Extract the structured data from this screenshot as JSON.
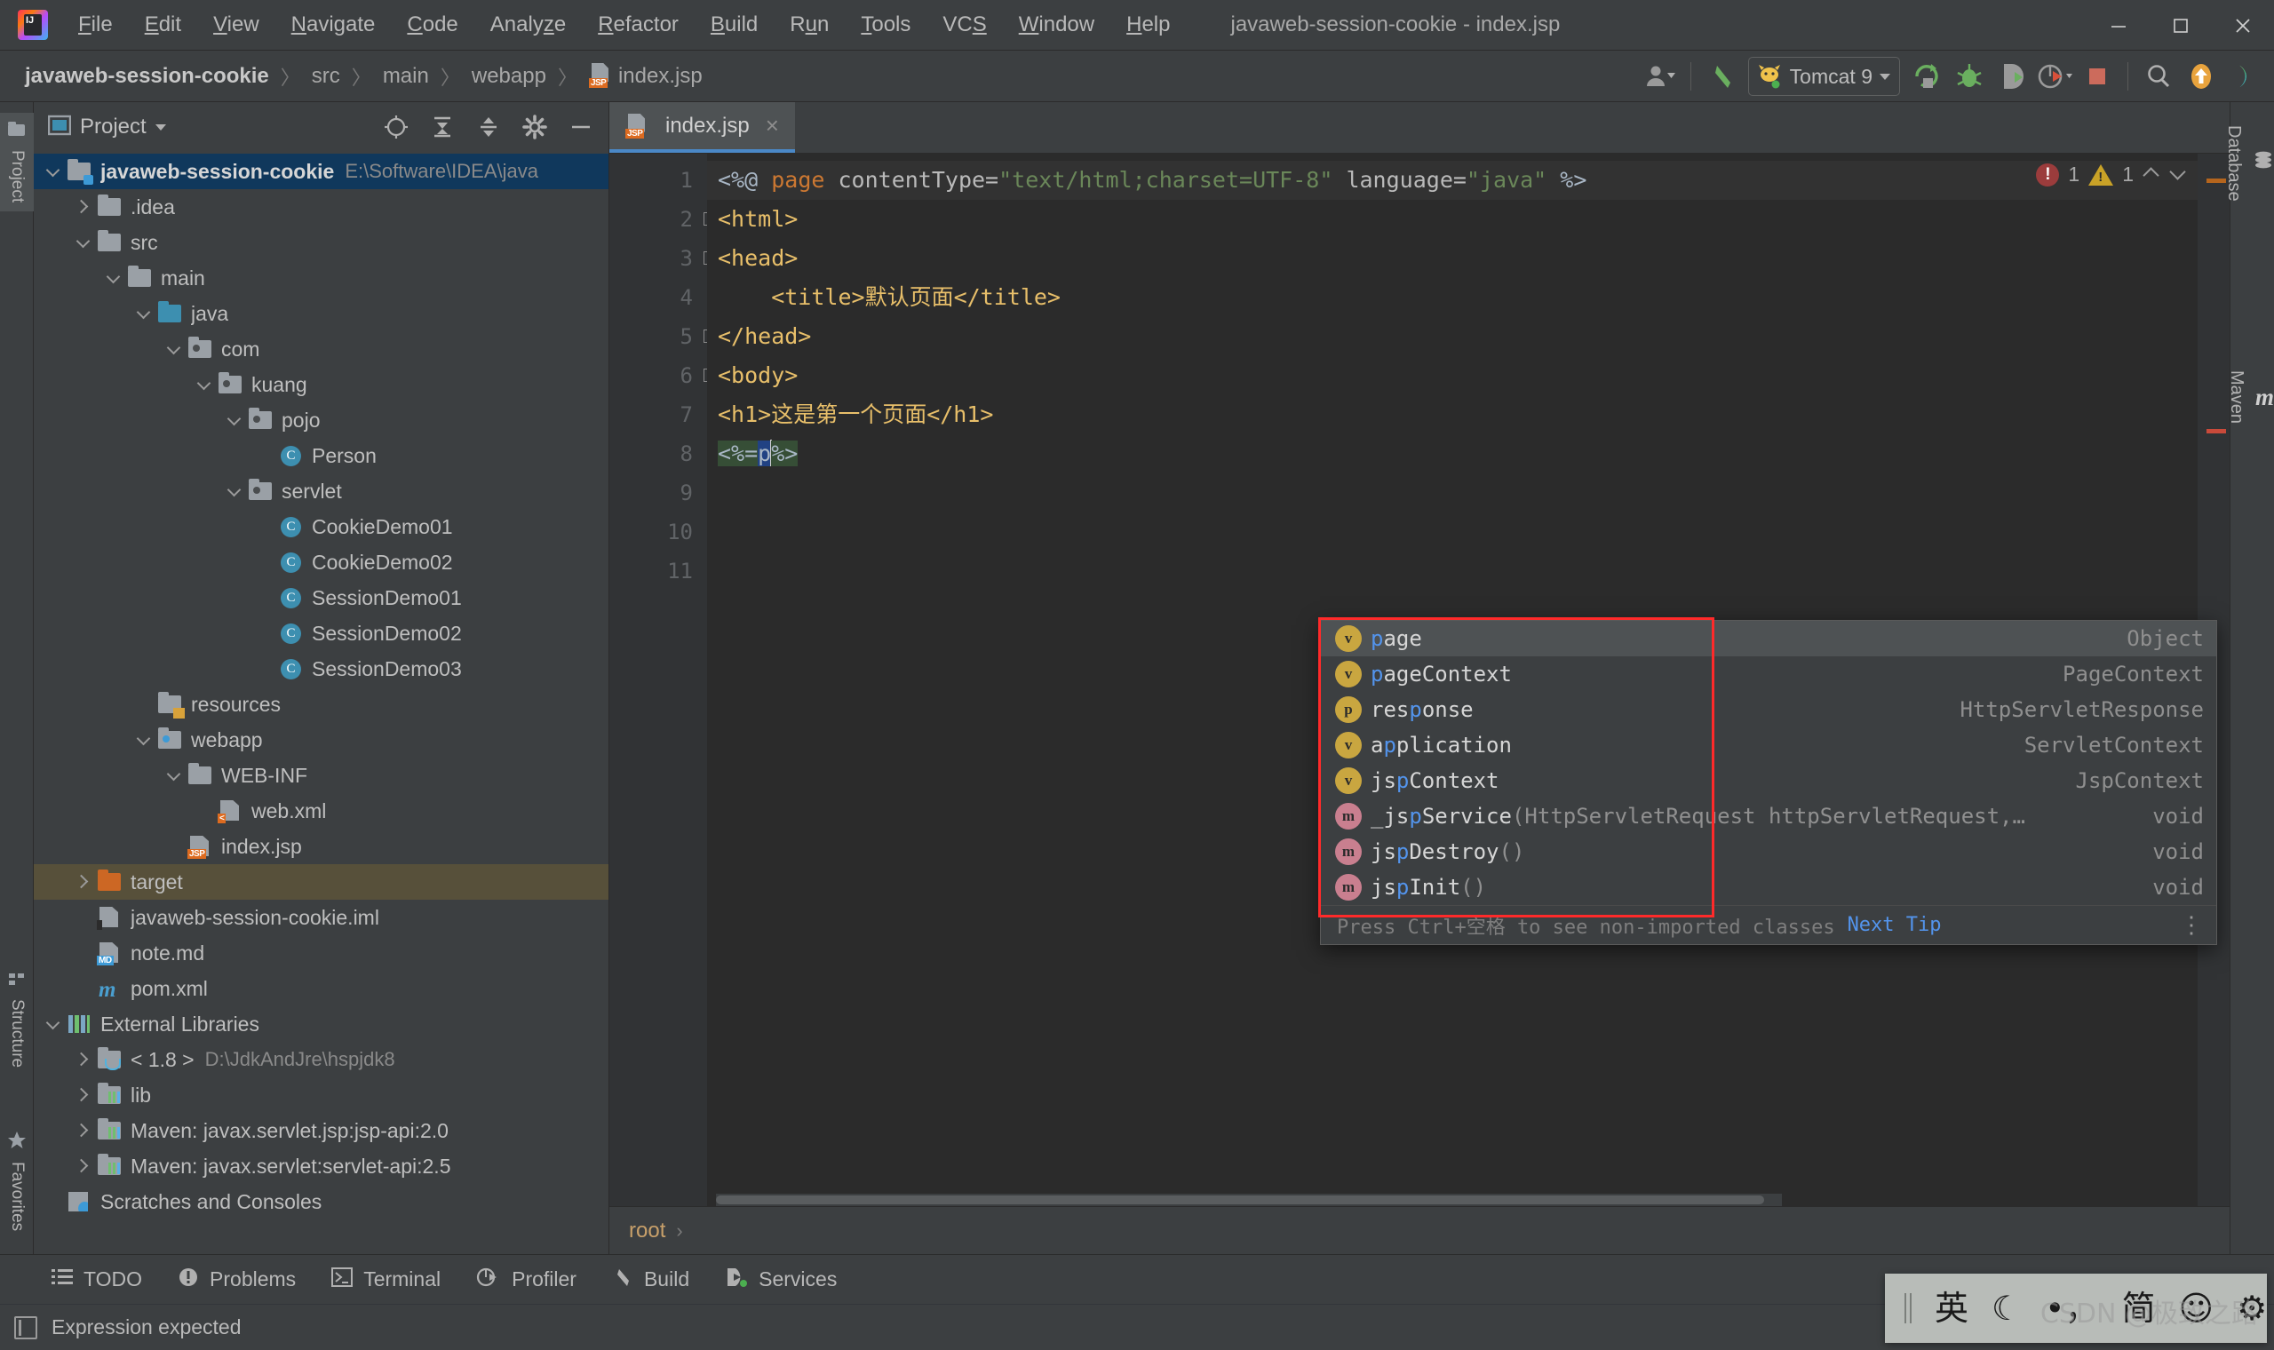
{
  "window": {
    "title": "javaweb-session-cookie - index.jsp",
    "logo_name": "intellij-idea-logo"
  },
  "menu": {
    "items": [
      {
        "label": "File",
        "mnemonic": "F"
      },
      {
        "label": "Edit",
        "mnemonic": "E"
      },
      {
        "label": "View",
        "mnemonic": "V"
      },
      {
        "label": "Navigate",
        "mnemonic": "N"
      },
      {
        "label": "Code",
        "mnemonic": "C"
      },
      {
        "label": "Analyze",
        "mnemonic": "z"
      },
      {
        "label": "Refactor",
        "mnemonic": "R"
      },
      {
        "label": "Build",
        "mnemonic": "B"
      },
      {
        "label": "Run",
        "mnemonic": "u"
      },
      {
        "label": "Tools",
        "mnemonic": "T"
      },
      {
        "label": "VCS",
        "mnemonic": "S"
      },
      {
        "label": "Window",
        "mnemonic": "W"
      },
      {
        "label": "Help",
        "mnemonic": "H"
      }
    ]
  },
  "window_controls": {
    "minimize": "minimize-icon",
    "maximize": "maximize-icon",
    "close": "close-icon"
  },
  "navbar": {
    "breadcrumb": [
      "javaweb-session-cookie",
      "src",
      "main",
      "webapp",
      "index.jsp"
    ],
    "file_icon_label": "JSP"
  },
  "toolbar": {
    "user_icon": "user-avatar-icon",
    "back_icon": "back-arrow-icon",
    "run_config": "Tomcat 9",
    "run_icon": "run-icon",
    "debug_icon": "debug-icon",
    "run_coverage_icon": "run-with-coverage-icon",
    "profile_icon": "profiler-icon",
    "stop_icon": "stop-icon",
    "search_icon": "search-everywhere-icon",
    "update_icon": "update-project-icon",
    "settings_icon": "ide-settings-icon"
  },
  "left_stripe": [
    {
      "label": "Project",
      "active": true
    },
    {
      "label": "Structure",
      "active": false
    },
    {
      "label": "Favorites",
      "active": false
    }
  ],
  "right_stripe": [
    {
      "label": "Database"
    },
    {
      "label": "Maven"
    }
  ],
  "project_panel": {
    "title": "Project",
    "actions": [
      "locate-icon",
      "expand-all-icon",
      "collapse-all-icon",
      "settings-icon",
      "hide-icon"
    ],
    "tree": [
      {
        "label": "javaweb-session-cookie",
        "sub": "E:\\Software\\IDEA\\java",
        "depth": 0,
        "arrow": "down",
        "icon": "module-folder",
        "bold": true,
        "selected": "blue"
      },
      {
        "label": ".idea",
        "sub": "",
        "depth": 1,
        "arrow": "right",
        "icon": "folder-grey",
        "bold": false,
        "selected": ""
      },
      {
        "label": "src",
        "sub": "",
        "depth": 1,
        "arrow": "down",
        "icon": "folder-grey",
        "bold": false,
        "selected": ""
      },
      {
        "label": "main",
        "sub": "",
        "depth": 2,
        "arrow": "down",
        "icon": "folder-grey",
        "bold": false,
        "selected": ""
      },
      {
        "label": "java",
        "sub": "",
        "depth": 3,
        "arrow": "down",
        "icon": "folder-source",
        "bold": false,
        "selected": ""
      },
      {
        "label": "com",
        "sub": "",
        "depth": 4,
        "arrow": "down",
        "icon": "folder-package",
        "bold": false,
        "selected": ""
      },
      {
        "label": "kuang",
        "sub": "",
        "depth": 5,
        "arrow": "down",
        "icon": "folder-package",
        "bold": false,
        "selected": ""
      },
      {
        "label": "pojo",
        "sub": "",
        "depth": 6,
        "arrow": "down",
        "icon": "folder-package",
        "bold": false,
        "selected": ""
      },
      {
        "label": "Person",
        "sub": "",
        "depth": 7,
        "arrow": "blank",
        "icon": "class-icon",
        "bold": false,
        "selected": ""
      },
      {
        "label": "servlet",
        "sub": "",
        "depth": 6,
        "arrow": "down",
        "icon": "folder-package",
        "bold": false,
        "selected": ""
      },
      {
        "label": "CookieDemo01",
        "sub": "",
        "depth": 7,
        "arrow": "blank",
        "icon": "class-icon",
        "bold": false,
        "selected": ""
      },
      {
        "label": "CookieDemo02",
        "sub": "",
        "depth": 7,
        "arrow": "blank",
        "icon": "class-icon",
        "bold": false,
        "selected": ""
      },
      {
        "label": "SessionDemo01",
        "sub": "",
        "depth": 7,
        "arrow": "blank",
        "icon": "class-icon",
        "bold": false,
        "selected": ""
      },
      {
        "label": "SessionDemo02",
        "sub": "",
        "depth": 7,
        "arrow": "blank",
        "icon": "class-icon",
        "bold": false,
        "selected": ""
      },
      {
        "label": "SessionDemo03",
        "sub": "",
        "depth": 7,
        "arrow": "blank",
        "icon": "class-icon",
        "bold": false,
        "selected": ""
      },
      {
        "label": "resources",
        "sub": "",
        "depth": 3,
        "arrow": "blank",
        "icon": "folder-resources",
        "bold": false,
        "selected": ""
      },
      {
        "label": "webapp",
        "sub": "",
        "depth": 3,
        "arrow": "down",
        "icon": "folder-webapp",
        "bold": false,
        "selected": ""
      },
      {
        "label": "WEB-INF",
        "sub": "",
        "depth": 4,
        "arrow": "down",
        "icon": "folder-grey",
        "bold": false,
        "selected": ""
      },
      {
        "label": "web.xml",
        "sub": "",
        "depth": 5,
        "arrow": "blank",
        "icon": "file-xml",
        "bold": false,
        "selected": ""
      },
      {
        "label": "index.jsp",
        "sub": "",
        "depth": 4,
        "arrow": "blank",
        "icon": "file-jsp",
        "bold": false,
        "selected": ""
      },
      {
        "label": "target",
        "sub": "",
        "depth": 1,
        "arrow": "right",
        "icon": "folder-excluded",
        "bold": false,
        "selected": "olive"
      },
      {
        "label": "javaweb-session-cookie.iml",
        "sub": "",
        "depth": 1,
        "arrow": "blank",
        "icon": "file-iml",
        "bold": false,
        "selected": ""
      },
      {
        "label": "note.md",
        "sub": "",
        "depth": 1,
        "arrow": "blank",
        "icon": "file-md",
        "bold": false,
        "selected": ""
      },
      {
        "label": "pom.xml",
        "sub": "",
        "depth": 1,
        "arrow": "blank",
        "icon": "file-maven",
        "bold": false,
        "selected": ""
      },
      {
        "label": "External Libraries",
        "sub": "",
        "depth": 0,
        "arrow": "down",
        "icon": "libraries-icon",
        "bold": false,
        "selected": ""
      },
      {
        "label": "< 1.8 >",
        "sub": "D:\\JdkAndJre\\hspjdk8",
        "depth": 1,
        "arrow": "right",
        "icon": "jdk-icon",
        "bold": false,
        "selected": ""
      },
      {
        "label": "lib",
        "sub": "",
        "depth": 1,
        "arrow": "right",
        "icon": "jar-icon",
        "bold": false,
        "selected": ""
      },
      {
        "label": "Maven: javax.servlet.jsp:jsp-api:2.0",
        "sub": "",
        "depth": 1,
        "arrow": "right",
        "icon": "jar-icon",
        "bold": false,
        "selected": ""
      },
      {
        "label": "Maven: javax.servlet:servlet-api:2.5",
        "sub": "",
        "depth": 1,
        "arrow": "right",
        "icon": "jar-icon",
        "bold": false,
        "selected": ""
      },
      {
        "label": "Scratches and Consoles",
        "sub": "",
        "depth": 0,
        "arrow": "blank",
        "icon": "scratches-icon",
        "bold": false,
        "selected": ""
      }
    ]
  },
  "editor": {
    "tab": {
      "label": "index.jsp",
      "icon": "JSP",
      "close": "×"
    },
    "inspection": {
      "errors": "1",
      "warnings": "1",
      "up": "chevron-up-icon",
      "down": "chevron-down-icon"
    },
    "line_numbers": [
      "1",
      "2",
      "3",
      "4",
      "5",
      "6",
      "7",
      "8",
      "9",
      "10",
      "11"
    ],
    "lines": [
      {
        "n": "1",
        "segments": [
          {
            "t": "<%@ ",
            "c": "tk-gray"
          },
          {
            "t": "page ",
            "c": "tk-orange"
          },
          {
            "t": "contentType=",
            "c": "tk-attr"
          },
          {
            "t": "\"text/html;charset=UTF-8\"",
            "c": "tk-green"
          },
          {
            "t": " language=",
            "c": "tk-attr"
          },
          {
            "t": "\"java\"",
            "c": "tk-green"
          },
          {
            "t": " %>",
            "c": "tk-gray"
          }
        ]
      },
      {
        "n": "2",
        "segments": [
          {
            "t": "<html>",
            "c": "tk-tag"
          }
        ]
      },
      {
        "n": "3",
        "segments": [
          {
            "t": "<head>",
            "c": "tk-tag"
          }
        ]
      },
      {
        "n": "4",
        "segments": [
          {
            "t": "    <title>默认页面</title>",
            "c": "tk-tag"
          }
        ]
      },
      {
        "n": "5",
        "segments": [
          {
            "t": "</head>",
            "c": "tk-tag"
          }
        ]
      },
      {
        "n": "6",
        "segments": [
          {
            "t": "<body>",
            "c": "tk-tag"
          }
        ]
      },
      {
        "n": "7",
        "segments": [
          {
            "t": "<h1>这是第一个页面</h1>",
            "c": "tk-tag"
          }
        ]
      },
      {
        "n": "8",
        "segments": [
          {
            "t": "<%=p%>",
            "c": "tk-gray"
          }
        ]
      }
    ],
    "breadcrumb_bottom": "root"
  },
  "completion_popup": {
    "items": [
      {
        "kind": "v",
        "name_pre": "",
        "name_match": "p",
        "name_post": "age",
        "sig": "",
        "type": "Object",
        "active": true
      },
      {
        "kind": "v",
        "name_pre": "",
        "name_match": "p",
        "name_post": "ageContext",
        "sig": "",
        "type": "PageContext",
        "active": false
      },
      {
        "kind": "p",
        "name_pre": "res",
        "name_match": "p",
        "name_post": "onse",
        "sig": "",
        "type": "HttpServletResponse",
        "active": false
      },
      {
        "kind": "v",
        "name_pre": "a",
        "name_match": "p",
        "name_post": "plication",
        "sig": "",
        "type": "ServletContext",
        "active": false
      },
      {
        "kind": "v",
        "name_pre": "js",
        "name_match": "p",
        "name_post": "Context",
        "sig": "",
        "type": "JspContext",
        "active": false
      },
      {
        "kind": "m",
        "name_pre": "_js",
        "name_match": "p",
        "name_post": "Service",
        "sig": "(HttpServletRequest httpServletRequest,…",
        "type": "void",
        "active": false
      },
      {
        "kind": "m",
        "name_pre": "js",
        "name_match": "p",
        "name_post": "Destroy",
        "sig": "()",
        "type": "void",
        "active": false
      },
      {
        "kind": "m",
        "name_pre": "js",
        "name_match": "p",
        "name_post": "Init",
        "sig": "()",
        "type": "void",
        "active": false
      }
    ],
    "footer_hint": "Press Ctrl+空格 to see non-imported classes",
    "footer_link": "Next Tip",
    "footer_menu": "more-options-icon"
  },
  "bottom_tools": [
    {
      "label": "TODO",
      "icon": "todo-icon"
    },
    {
      "label": "Problems",
      "icon": "problems-icon"
    },
    {
      "label": "Terminal",
      "icon": "terminal-icon"
    },
    {
      "label": "Profiler",
      "icon": "profiler-icon"
    },
    {
      "label": "Build",
      "icon": "build-icon"
    },
    {
      "label": "Services",
      "icon": "services-icon"
    }
  ],
  "status_bar": {
    "message": "Expression expected",
    "icon": "status-message-icon"
  },
  "ime_bar": {
    "items": [
      "英",
      "☾",
      "•，",
      "简",
      "☺",
      "⚙"
    ],
    "grip": "drag-grip-icon"
  },
  "watermark": "CSDN @极致之路",
  "colors": {
    "accent_blue": "#4a88c7",
    "selection_blue": "#10385c",
    "selection_olive": "#57503a",
    "error_red": "#ff2a2a",
    "panel_bg": "#3c3f41",
    "editor_bg": "#2b2b2b"
  }
}
